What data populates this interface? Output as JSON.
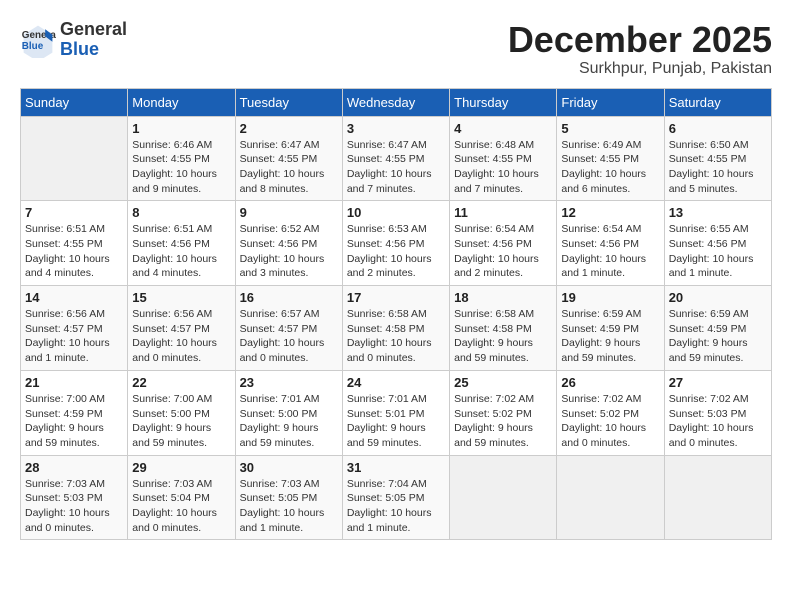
{
  "header": {
    "logo_general": "General",
    "logo_blue": "Blue",
    "month": "December 2025",
    "location": "Surkhpur, Punjab, Pakistan"
  },
  "days_of_week": [
    "Sunday",
    "Monday",
    "Tuesday",
    "Wednesday",
    "Thursday",
    "Friday",
    "Saturday"
  ],
  "weeks": [
    [
      {
        "day": "",
        "info": ""
      },
      {
        "day": "1",
        "info": "Sunrise: 6:46 AM\nSunset: 4:55 PM\nDaylight: 10 hours\nand 9 minutes."
      },
      {
        "day": "2",
        "info": "Sunrise: 6:47 AM\nSunset: 4:55 PM\nDaylight: 10 hours\nand 8 minutes."
      },
      {
        "day": "3",
        "info": "Sunrise: 6:47 AM\nSunset: 4:55 PM\nDaylight: 10 hours\nand 7 minutes."
      },
      {
        "day": "4",
        "info": "Sunrise: 6:48 AM\nSunset: 4:55 PM\nDaylight: 10 hours\nand 7 minutes."
      },
      {
        "day": "5",
        "info": "Sunrise: 6:49 AM\nSunset: 4:55 PM\nDaylight: 10 hours\nand 6 minutes."
      },
      {
        "day": "6",
        "info": "Sunrise: 6:50 AM\nSunset: 4:55 PM\nDaylight: 10 hours\nand 5 minutes."
      }
    ],
    [
      {
        "day": "7",
        "info": "Sunrise: 6:51 AM\nSunset: 4:55 PM\nDaylight: 10 hours\nand 4 minutes."
      },
      {
        "day": "8",
        "info": "Sunrise: 6:51 AM\nSunset: 4:56 PM\nDaylight: 10 hours\nand 4 minutes."
      },
      {
        "day": "9",
        "info": "Sunrise: 6:52 AM\nSunset: 4:56 PM\nDaylight: 10 hours\nand 3 minutes."
      },
      {
        "day": "10",
        "info": "Sunrise: 6:53 AM\nSunset: 4:56 PM\nDaylight: 10 hours\nand 2 minutes."
      },
      {
        "day": "11",
        "info": "Sunrise: 6:54 AM\nSunset: 4:56 PM\nDaylight: 10 hours\nand 2 minutes."
      },
      {
        "day": "12",
        "info": "Sunrise: 6:54 AM\nSunset: 4:56 PM\nDaylight: 10 hours\nand 1 minute."
      },
      {
        "day": "13",
        "info": "Sunrise: 6:55 AM\nSunset: 4:56 PM\nDaylight: 10 hours\nand 1 minute."
      }
    ],
    [
      {
        "day": "14",
        "info": "Sunrise: 6:56 AM\nSunset: 4:57 PM\nDaylight: 10 hours\nand 1 minute."
      },
      {
        "day": "15",
        "info": "Sunrise: 6:56 AM\nSunset: 4:57 PM\nDaylight: 10 hours\nand 0 minutes."
      },
      {
        "day": "16",
        "info": "Sunrise: 6:57 AM\nSunset: 4:57 PM\nDaylight: 10 hours\nand 0 minutes."
      },
      {
        "day": "17",
        "info": "Sunrise: 6:58 AM\nSunset: 4:58 PM\nDaylight: 10 hours\nand 0 minutes."
      },
      {
        "day": "18",
        "info": "Sunrise: 6:58 AM\nSunset: 4:58 PM\nDaylight: 9 hours\nand 59 minutes."
      },
      {
        "day": "19",
        "info": "Sunrise: 6:59 AM\nSunset: 4:59 PM\nDaylight: 9 hours\nand 59 minutes."
      },
      {
        "day": "20",
        "info": "Sunrise: 6:59 AM\nSunset: 4:59 PM\nDaylight: 9 hours\nand 59 minutes."
      }
    ],
    [
      {
        "day": "21",
        "info": "Sunrise: 7:00 AM\nSunset: 4:59 PM\nDaylight: 9 hours\nand 59 minutes."
      },
      {
        "day": "22",
        "info": "Sunrise: 7:00 AM\nSunset: 5:00 PM\nDaylight: 9 hours\nand 59 minutes."
      },
      {
        "day": "23",
        "info": "Sunrise: 7:01 AM\nSunset: 5:00 PM\nDaylight: 9 hours\nand 59 minutes."
      },
      {
        "day": "24",
        "info": "Sunrise: 7:01 AM\nSunset: 5:01 PM\nDaylight: 9 hours\nand 59 minutes."
      },
      {
        "day": "25",
        "info": "Sunrise: 7:02 AM\nSunset: 5:02 PM\nDaylight: 9 hours\nand 59 minutes."
      },
      {
        "day": "26",
        "info": "Sunrise: 7:02 AM\nSunset: 5:02 PM\nDaylight: 10 hours\nand 0 minutes."
      },
      {
        "day": "27",
        "info": "Sunrise: 7:02 AM\nSunset: 5:03 PM\nDaylight: 10 hours\nand 0 minutes."
      }
    ],
    [
      {
        "day": "28",
        "info": "Sunrise: 7:03 AM\nSunset: 5:03 PM\nDaylight: 10 hours\nand 0 minutes."
      },
      {
        "day": "29",
        "info": "Sunrise: 7:03 AM\nSunset: 5:04 PM\nDaylight: 10 hours\nand 0 minutes."
      },
      {
        "day": "30",
        "info": "Sunrise: 7:03 AM\nSunset: 5:05 PM\nDaylight: 10 hours\nand 1 minute."
      },
      {
        "day": "31",
        "info": "Sunrise: 7:04 AM\nSunset: 5:05 PM\nDaylight: 10 hours\nand 1 minute."
      },
      {
        "day": "",
        "info": ""
      },
      {
        "day": "",
        "info": ""
      },
      {
        "day": "",
        "info": ""
      }
    ]
  ]
}
